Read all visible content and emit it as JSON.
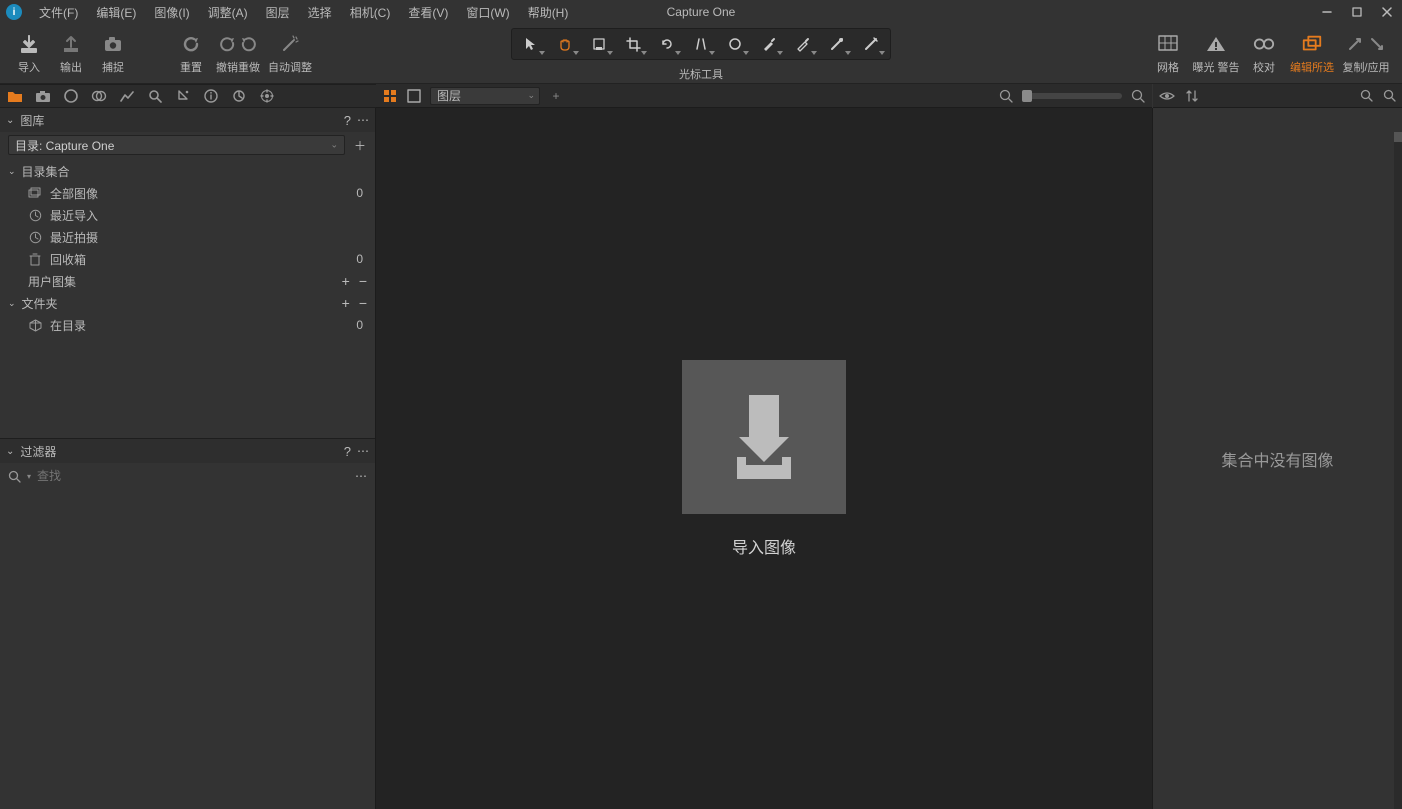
{
  "app_title": "Capture One",
  "menu": [
    "文件(F)",
    "编辑(E)",
    "图像(I)",
    "调整(A)",
    "图层",
    "选择",
    "相机(C)",
    "查看(V)",
    "窗口(W)",
    "帮助(H)"
  ],
  "toolbar": {
    "left": [
      {
        "name": "import-button",
        "label": "导入",
        "icon": "download"
      },
      {
        "name": "export-button",
        "label": "输出",
        "icon": "upload"
      },
      {
        "name": "capture-button",
        "label": "捕捉",
        "icon": "camera"
      }
    ],
    "mid": [
      {
        "name": "reset-button",
        "label": "重置",
        "icon": "undo-big"
      },
      {
        "name": "undo-redo-button",
        "label": "撤销重做",
        "icon": "undo-redo"
      },
      {
        "name": "auto-adjust-button",
        "label": "自动调整",
        "icon": "wand"
      }
    ],
    "cursor_label": "光标工具",
    "right": [
      {
        "name": "grid-button",
        "label": "网格",
        "icon": "grid"
      },
      {
        "name": "exposure-warning-button",
        "label": "曝光 警告",
        "icon": "warning"
      },
      {
        "name": "proof-button",
        "label": "校对",
        "icon": "glasses"
      },
      {
        "name": "edit-selected-button",
        "label": "编辑所选",
        "icon": "stack",
        "active": true
      },
      {
        "name": "copy-apply-button",
        "label": "复制/应用",
        "icon": "arrow-pair"
      }
    ]
  },
  "library": {
    "title": "图库",
    "catalog_label": "目录: Capture One",
    "sections": {
      "catalog_collection": "目录集合",
      "user_collection": "用户图集",
      "folders": "文件夹"
    },
    "items": {
      "all_images": {
        "label": "全部图像",
        "count": "0"
      },
      "recent_import": {
        "label": "最近导入",
        "count": ""
      },
      "recent_capture": {
        "label": "最近拍摄",
        "count": ""
      },
      "trash": {
        "label": "回收箱",
        "count": "0"
      },
      "in_catalog": {
        "label": "在目录",
        "count": "0"
      }
    }
  },
  "filter": {
    "title": "过滤器",
    "search_placeholder": "查找"
  },
  "viewer": {
    "layer_select": "图层",
    "import_label": "导入图像"
  },
  "right": {
    "empty_message": "集合中没有图像"
  }
}
